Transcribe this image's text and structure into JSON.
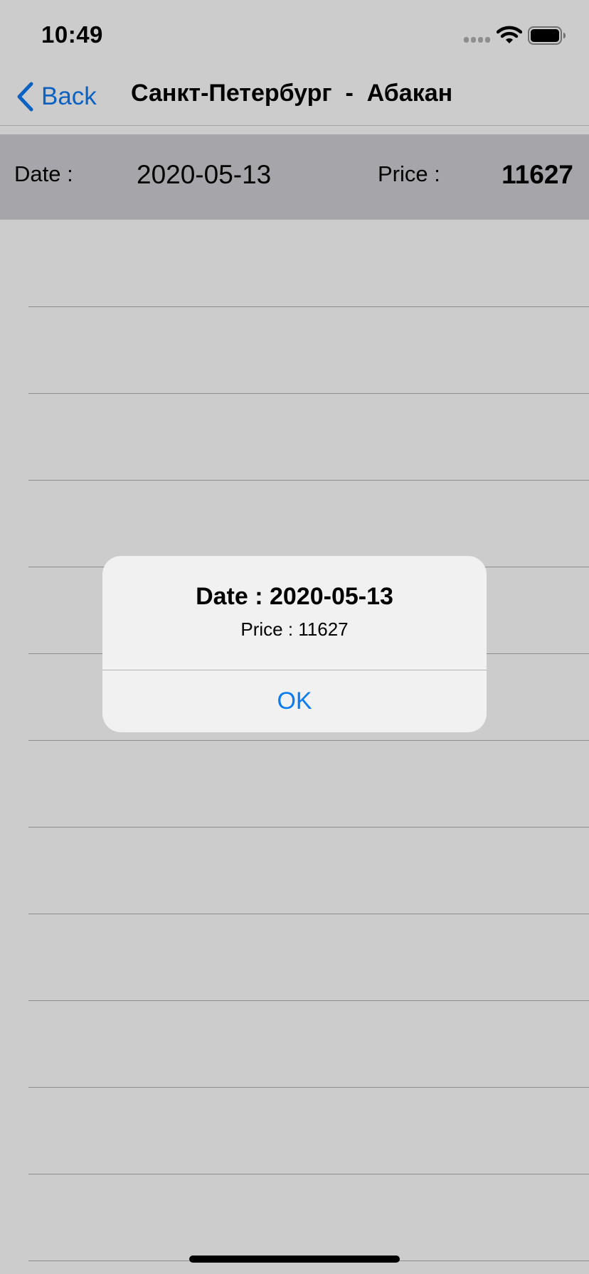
{
  "status_bar": {
    "time": "10:49",
    "icons": [
      "cellular-signal-icon",
      "wifi-icon",
      "battery-icon"
    ]
  },
  "nav": {
    "back_label": "Back",
    "back_icon": "chevron-left-icon",
    "title": "Санкт-Петербург  -  Абакан"
  },
  "selected_row": {
    "date_label": "Date :",
    "date_value": "2020-05-13",
    "price_label": "Price :",
    "price_value": "11627"
  },
  "alert": {
    "title": "Date : 2020-05-13",
    "message": "Price : 11627",
    "ok_label": "OK"
  },
  "colors": {
    "accent": "#0b62c3",
    "alert_button": "#0a7cf0",
    "background": "#cccccc",
    "selected_row": "#a6a5aa",
    "alert_background": "#f1f1f1"
  }
}
